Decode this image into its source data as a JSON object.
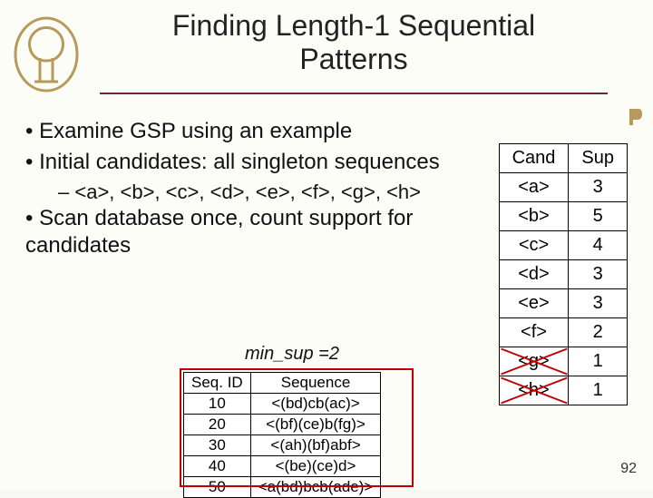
{
  "title": {
    "line1": "Finding Length-1 Sequential",
    "line2": "Patterns"
  },
  "bullets": {
    "b1": "Examine GSP using an example",
    "b2": "Initial candidates: all singleton sequences",
    "b2a_prefix": "",
    "b2a_items": "<a>, <b>, <c>, <d>, <e>, <f>, <g>, <h>",
    "b3": "Scan database once, count support for candidates"
  },
  "min_sup_label": "min_sup =2",
  "seq_table": {
    "headers": [
      "Seq. ID",
      "Sequence"
    ],
    "rows": [
      [
        "10",
        "<(bd)cb(ac)>"
      ],
      [
        "20",
        "<(bf)(ce)b(fg)>"
      ],
      [
        "30",
        "<(ah)(bf)abf>"
      ],
      [
        "40",
        "<(be)(ce)d>"
      ],
      [
        "50",
        "<a(bd)bcb(ade)>"
      ]
    ]
  },
  "cand_table": {
    "headers": [
      "Cand",
      "Sup"
    ],
    "rows": [
      {
        "cand": "<a>",
        "sup": "3",
        "struck": false
      },
      {
        "cand": "<b>",
        "sup": "5",
        "struck": false
      },
      {
        "cand": "<c>",
        "sup": "4",
        "struck": false
      },
      {
        "cand": "<d>",
        "sup": "3",
        "struck": false
      },
      {
        "cand": "<e>",
        "sup": "3",
        "struck": false
      },
      {
        "cand": "<f>",
        "sup": "2",
        "struck": false
      },
      {
        "cand": "<g>",
        "sup": "1",
        "struck": true
      },
      {
        "cand": "<h>",
        "sup": "1",
        "struck": true
      }
    ]
  },
  "page_number": "92",
  "chart_data": {
    "type": "table",
    "tables": [
      {
        "name": "candidate_support",
        "columns": [
          "Cand",
          "Sup"
        ],
        "rows": [
          [
            "<a>",
            3
          ],
          [
            "<b>",
            5
          ],
          [
            "<c>",
            4
          ],
          [
            "<d>",
            3
          ],
          [
            "<e>",
            3
          ],
          [
            "<f>",
            2
          ],
          [
            "<g>",
            1
          ],
          [
            "<h>",
            1
          ]
        ],
        "min_sup": 2,
        "below_min_sup": [
          "<g>",
          "<h>"
        ]
      },
      {
        "name": "sequence_database",
        "columns": [
          "Seq. ID",
          "Sequence"
        ],
        "rows": [
          [
            "10",
            "<(bd)cb(ac)>"
          ],
          [
            "20",
            "<(bf)(ce)b(fg)>"
          ],
          [
            "30",
            "<(ah)(bf)abf>"
          ],
          [
            "40",
            "<(be)(ce)d>"
          ],
          [
            "50",
            "<a(bd)bcb(ade)>"
          ]
        ]
      }
    ]
  }
}
